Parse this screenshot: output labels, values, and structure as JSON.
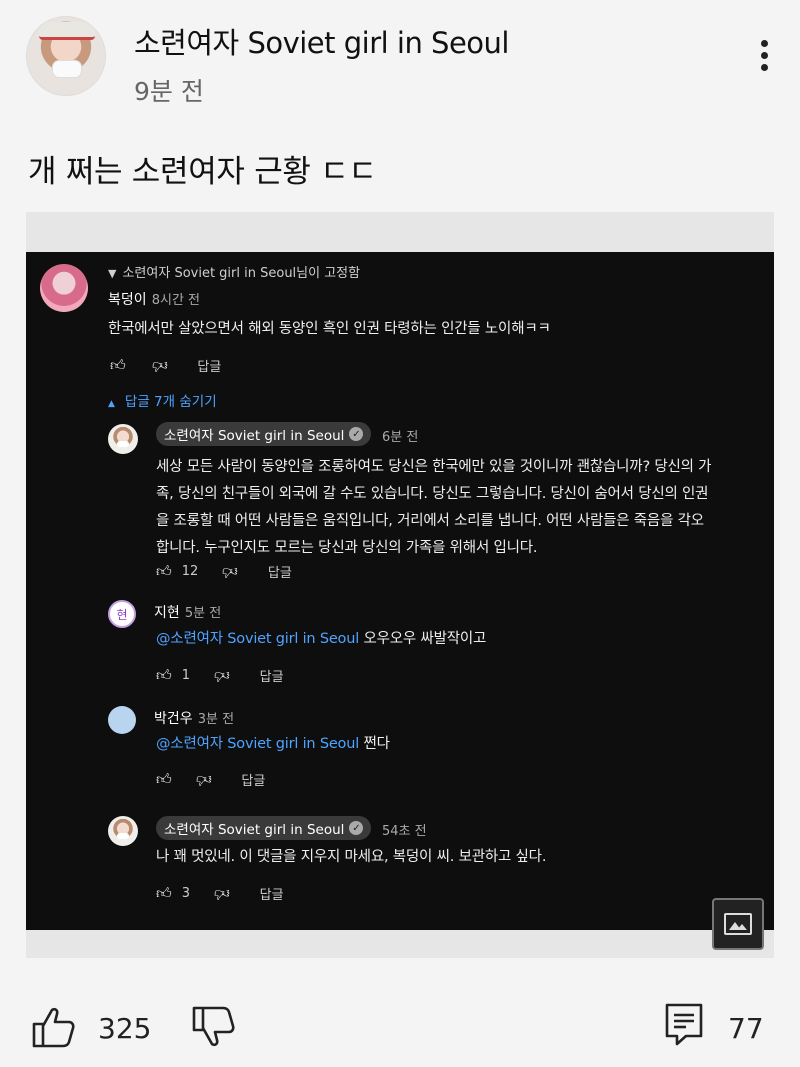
{
  "post": {
    "channel_name": "소련여자 Soviet girl in Seoul",
    "time": "9분 전",
    "text": "개 쩌는 소련여자 근황 ㄷㄷ",
    "like_count": "325",
    "comment_count": "77"
  },
  "screenshot": {
    "pinned_by": "소련여자 Soviet girl in Seoul님이 고정함",
    "comment": {
      "author": "복덩이",
      "time": "8시간 전",
      "text": "한국에서만 살았으면서 해외 동양인 흑인 인권 타령하는 인간들 노이해ㅋㅋ",
      "reply_label": "답글"
    },
    "replies_toggle": "답글 7개 숨기기",
    "replies": [
      {
        "author": "소련여자 Soviet girl in Seoul",
        "time": "6분 전",
        "lines": [
          "세상 모든 사람이 동양인을 조롱하여도 당신은 한국에만 있을 것이니까 괜찮습니까? 당신의 가",
          "족, 당신의 친구들이 외국에 갈 수도 있습니다. 당신도 그렇습니다. 당신이 숨어서 당신의 인권",
          "을 조롱할 때 어떤 사람들은 움직입니다, 거리에서 소리를 냅니다. 어떤 사람들은 죽음을 각오",
          "합니다. 누구인지도 모르는 당신과 당신의 가족을 위해서 입니다."
        ],
        "likes": "12",
        "reply_label": "답글"
      },
      {
        "author": "지현",
        "avatar_letter": "현",
        "time": "5분 전",
        "mention": "@소련여자 Soviet girl in Seoul",
        "text": "오우오우 싸발작이고",
        "likes": "1",
        "reply_label": "답글"
      },
      {
        "author": "박건우",
        "time": "3분 전",
        "mention": "@소련여자 Soviet girl in Seoul",
        "text": "쩐다",
        "likes": "",
        "reply_label": "답글"
      },
      {
        "author": "소련여자 Soviet girl in Seoul",
        "time": "54초 전",
        "text": "나 꽤 멋있네. 이 댓글을 지우지 마세요, 복덩이 씨. 보관하고 싶다.",
        "likes": "3",
        "reply_label": "답글"
      }
    ]
  },
  "colors": {
    "mention": "#4ea3ff",
    "dark_bg": "#0e0e0e",
    "page_bg": "#f4f4f4"
  }
}
